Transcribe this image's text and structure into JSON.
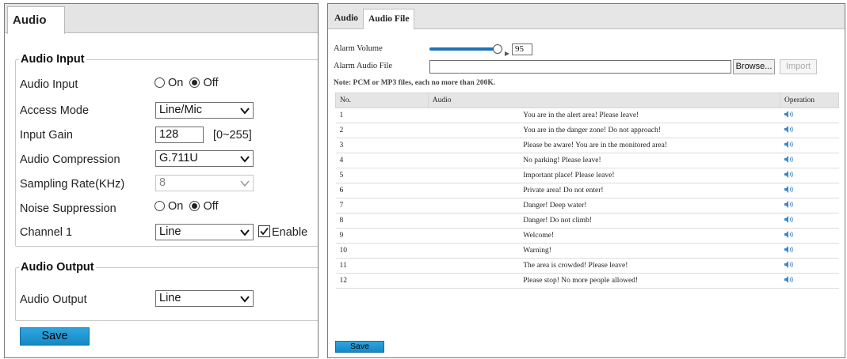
{
  "left": {
    "tab_label": "Audio",
    "audio_input_section": {
      "legend": "Audio Input",
      "audio_input": {
        "label": "Audio Input",
        "on_label": "On",
        "off_label": "Off",
        "selected": "Off"
      },
      "access_mode": {
        "label": "Access Mode",
        "value": "Line/Mic"
      },
      "input_gain": {
        "label": "Input Gain",
        "value": "128",
        "range": "[0~255]"
      },
      "audio_compression": {
        "label": "Audio Compression",
        "value": "G.711U"
      },
      "sampling_rate": {
        "label": "Sampling Rate(KHz)",
        "value": "8"
      },
      "noise_suppression": {
        "label": "Noise Suppression",
        "on_label": "On",
        "off_label": "Off",
        "selected": "Off"
      },
      "channel1": {
        "label": "Channel 1",
        "value": "Line",
        "enable_label": "Enable",
        "enabled": true
      }
    },
    "audio_output_section": {
      "legend": "Audio Output",
      "audio_output": {
        "label": "Audio Output",
        "value": "Line"
      }
    },
    "save_label": "Save"
  },
  "right": {
    "tabs": [
      {
        "label": "Audio",
        "active": false
      },
      {
        "label": "Audio File",
        "active": true
      }
    ],
    "alarm_volume": {
      "label": "Alarm Volume",
      "value": "95",
      "level_percent": 95
    },
    "alarm_audio_file": {
      "label": "Alarm Audio File",
      "value": "",
      "browse_label": "Browse...",
      "import_label": "Import"
    },
    "note": "Note: PCM or MP3 files, each no more than 200K.",
    "table": {
      "headers": {
        "no": "No.",
        "audio": "Audio",
        "operation": "Operation"
      },
      "rows": [
        {
          "no": "1",
          "audio": "You are in the alert area! Please leave!"
        },
        {
          "no": "2",
          "audio": "You are in the danger zone! Do not approach!"
        },
        {
          "no": "3",
          "audio": "Please be aware! You are in the monitored area!"
        },
        {
          "no": "4",
          "audio": "No parking! Please leave!"
        },
        {
          "no": "5",
          "audio": "Important place! Please leave!"
        },
        {
          "no": "6",
          "audio": "Private area! Do not enter!"
        },
        {
          "no": "7",
          "audio": "Danger! Deep water!"
        },
        {
          "no": "8",
          "audio": "Danger! Do not climb!"
        },
        {
          "no": "9",
          "audio": "Welcome!"
        },
        {
          "no": "10",
          "audio": "Warning!"
        },
        {
          "no": "11",
          "audio": "The area is crowded! Please leave!"
        },
        {
          "no": "12",
          "audio": "Please stop! No more people allowed!"
        }
      ],
      "operation_icon": "speaker-icon"
    },
    "save_label": "Save"
  },
  "colors": {
    "accent_blue": "#1f8fd0",
    "slider_blue": "#1f73b8",
    "tab_bar_gray": "#e4e4e4"
  }
}
